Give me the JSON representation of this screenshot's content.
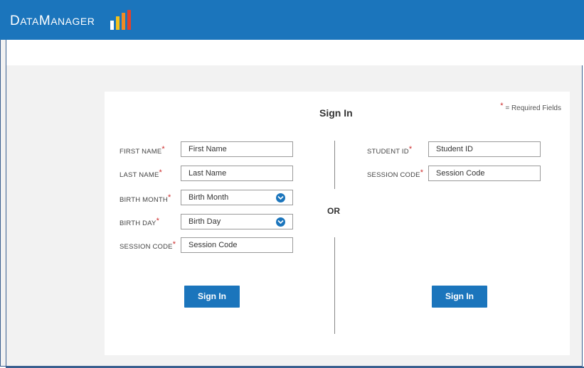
{
  "app": {
    "logo_text": "DataManager"
  },
  "form": {
    "title": "Sign In",
    "required_note_star": "*",
    "required_note": "= Required Fields",
    "separator": "OR",
    "left": {
      "first_name_label": "FIRST NAME",
      "first_name_placeholder": "First Name",
      "last_name_label": "LAST NAME",
      "last_name_placeholder": "Last Name",
      "birth_month_label": "BIRTH MONTH",
      "birth_month_value": "Birth Month",
      "birth_day_label": "BIRTH DAY",
      "birth_day_value": "Birth Day",
      "session_code_label": "SESSION CODE",
      "session_code_placeholder": "Session Code",
      "sign_in_label": "Sign In"
    },
    "right": {
      "student_id_label": "STUDENT ID",
      "student_id_placeholder": "Student ID",
      "session_code_label": "SESSION CODE",
      "session_code_placeholder": "Session Code",
      "sign_in_label": "Sign In"
    },
    "required_star": "*"
  },
  "colors": {
    "brand_blue": "#1b75bc",
    "required_red": "#cc2a2a",
    "logo_bar_colors": [
      "#ffffff",
      "#f5c21b",
      "#f08a24",
      "#e2412b"
    ]
  },
  "icons": {
    "dropdown": "chevron-down-icon",
    "logo": "bar-chart-logo-icon"
  }
}
